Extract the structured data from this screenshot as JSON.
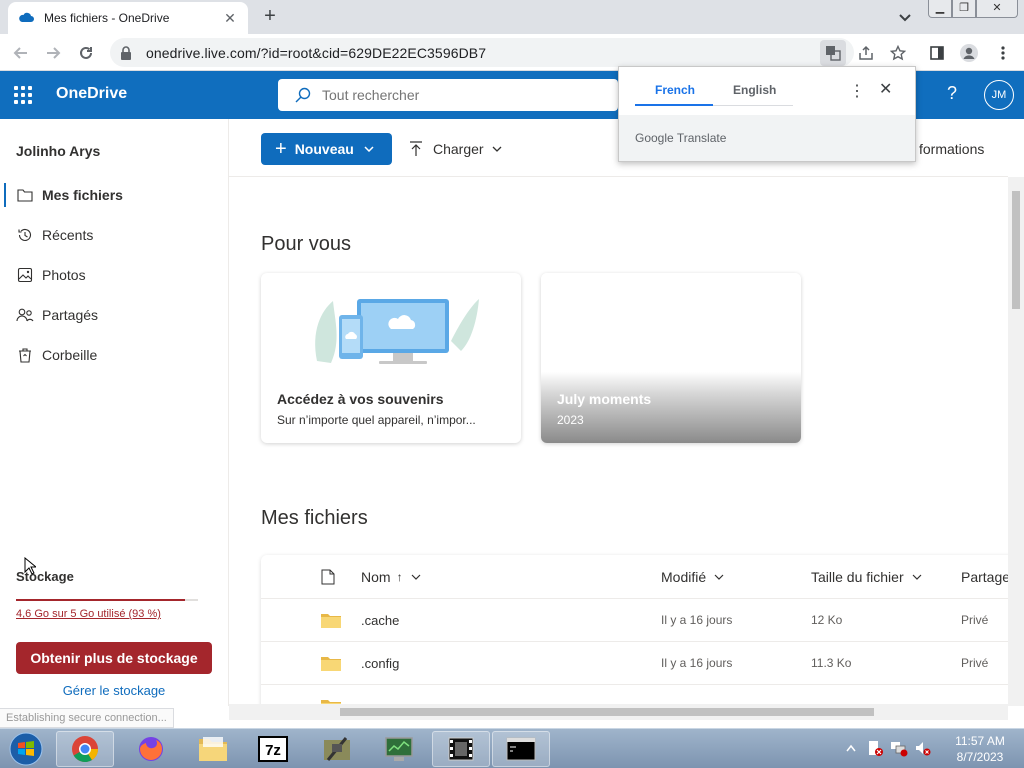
{
  "browser": {
    "tab_title": "Mes fichiers - OneDrive",
    "url": "onedrive.live.com/?id=root&cid=629DE22EC3596DB7"
  },
  "header": {
    "brand": "OneDrive",
    "search_placeholder": "Tout rechercher",
    "help": "?",
    "avatar_initials": "JM"
  },
  "sidebar": {
    "user_name": "Jolinho Arys",
    "items": [
      {
        "label": "Mes fichiers",
        "icon": "folder-icon",
        "active": true
      },
      {
        "label": "Récents",
        "icon": "history-icon",
        "active": false
      },
      {
        "label": "Photos",
        "icon": "photo-icon",
        "active": false
      },
      {
        "label": "Partagés",
        "icon": "people-icon",
        "active": false
      },
      {
        "label": "Corbeille",
        "icon": "trash-icon",
        "active": false
      }
    ],
    "storage": {
      "title": "Stockage",
      "usage_text": "4,6 Go sur 5 Go utilisé (93 %)",
      "used_fraction": 0.93,
      "more_button": "Obtenir plus de stockage",
      "manage_link": "Gérer le stockage"
    }
  },
  "command_bar": {
    "new_label": "Nouveau",
    "upload_label": "Charger",
    "info_label": "formations"
  },
  "for_you": {
    "title": "Pour vous",
    "cards": [
      {
        "title": "Accédez à vos souvenirs",
        "subtitle": "Sur n’importe quel appareil, n’impor..."
      },
      {
        "title": "July moments",
        "subtitle": "2023"
      }
    ]
  },
  "files": {
    "title": "Mes fichiers",
    "columns": {
      "name": "Nom",
      "sort_arrow": "↑",
      "modified": "Modifié",
      "size": "Taille du fichier",
      "sharing": "Partage"
    },
    "rows": [
      {
        "name": ".cache",
        "modified": "Il y a 16 jours",
        "size": "12 Ko",
        "sharing": "Privé"
      },
      {
        "name": ".config",
        "modified": "Il y a 16 jours",
        "size": "11.3 Ko",
        "sharing": "Privé"
      }
    ]
  },
  "translate_popup": {
    "source_lang": "French",
    "target_lang": "English",
    "brand_google": "Google",
    "brand_translate": "Translate"
  },
  "status_bar": "Establishing secure connection...",
  "taskbar": {
    "time": "11:57 AM",
    "date": "8/7/2023"
  },
  "colors": {
    "onedrive_blue": "#106ebe",
    "storage_red": "#a4262c",
    "folder_yellow": "#f8d775"
  }
}
